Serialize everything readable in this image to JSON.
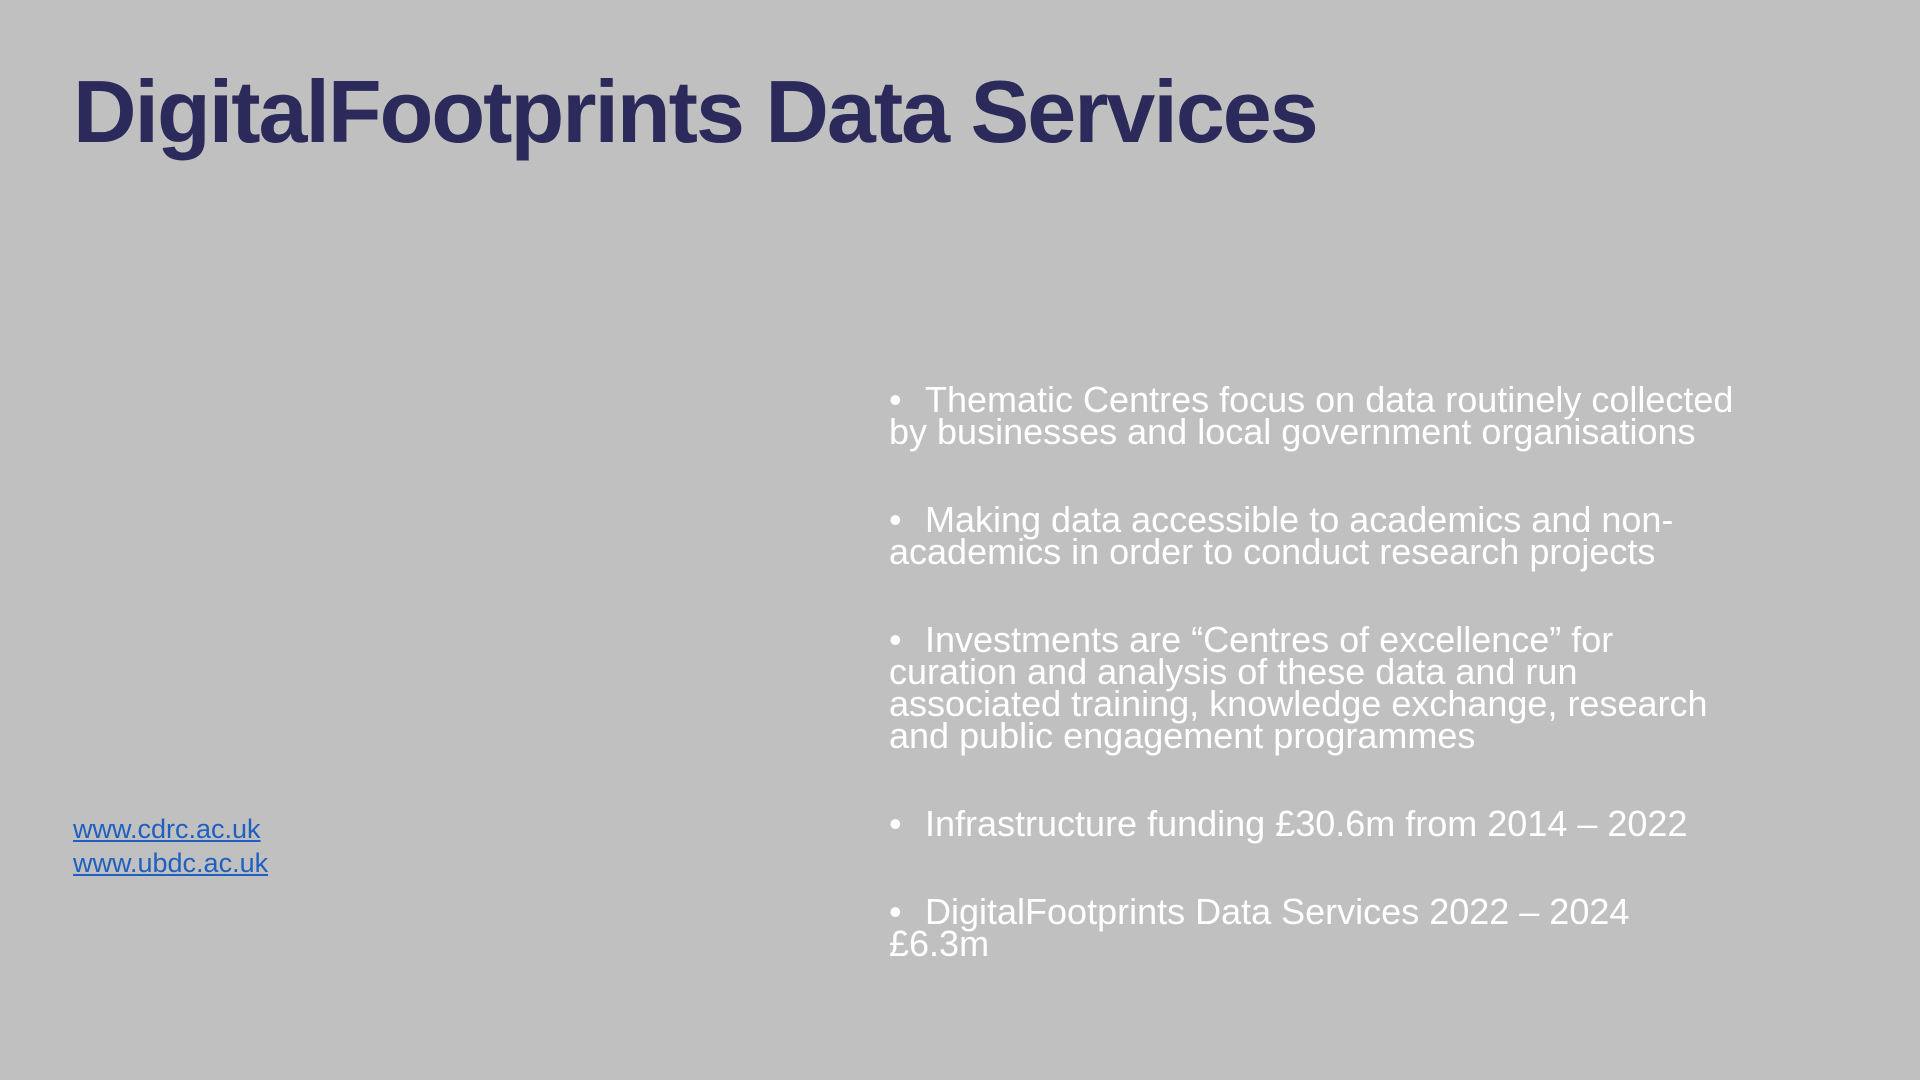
{
  "slide": {
    "title": "DigitalFootprints Data Services",
    "links": [
      "www.cdrc.ac.uk",
      "www.ubdc.ac.uk"
    ],
    "bullet_glyph": "•",
    "bullets": [
      {
        "line1": "Thematic Centres focus on data routinely collected",
        "rest": [
          "by businesses and local government organisations"
        ]
      },
      {
        "line1": "Making data accessible to academics and non-",
        "rest": [
          "academics in order to conduct research projects"
        ]
      },
      {
        "line1": "Investments are “Centres of excellence” for",
        "rest": [
          "curation and analysis of these data and run",
          "associated training, knowledge exchange, research",
          "and public engagement programmes"
        ]
      },
      {
        "line1": "Infrastructure funding £30.6m from 2014 – 2022",
        "rest": []
      },
      {
        "line1": "DigitalFootprints Data Services 2022 – 2024",
        "rest": [
          "£6.3m"
        ]
      }
    ],
    "colors": {
      "background": "#c0c0c0",
      "title": "#2b2a5a",
      "body_text": "#ffffff",
      "link": "#1f5fbf"
    }
  }
}
